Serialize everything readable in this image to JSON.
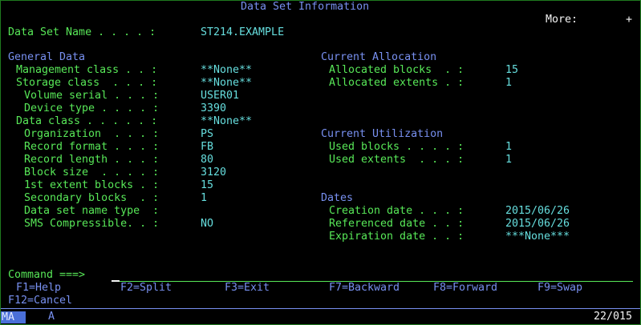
{
  "panel": {
    "title": "Data Set Information",
    "more_label": "More:",
    "more_indicator": "+"
  },
  "dataset": {
    "label": "Data Set Name . . . . :",
    "value": "ST214.EXAMPLE"
  },
  "general": {
    "heading": "General Data",
    "rows": [
      {
        "label": "Management class . . :",
        "value": "**None**"
      },
      {
        "label": "Storage class  . . . :",
        "value": "**None**"
      },
      {
        "label": "Volume serial . . . :",
        "value": "USER01"
      },
      {
        "label": "Device type . . . . :",
        "value": "3390"
      },
      {
        "label": "Data class . . . . . :",
        "value": "**None**"
      },
      {
        "label": "Organization  . . . :",
        "value": "PS"
      },
      {
        "label": "Record format . . . :",
        "value": "FB"
      },
      {
        "label": "Record length . . . :",
        "value": "80"
      },
      {
        "label": "Block size  . . . . :",
        "value": "3120"
      },
      {
        "label": "1st extent blocks . :",
        "value": "15"
      },
      {
        "label": "Secondary blocks  . :",
        "value": "1"
      },
      {
        "label": "Data set name type  :",
        "value": ""
      },
      {
        "label": "SMS Compressible. . :",
        "value": "NO"
      }
    ]
  },
  "allocation": {
    "heading": "Current Allocation",
    "rows": [
      {
        "label": "Allocated blocks  . :",
        "value": "15"
      },
      {
        "label": "Allocated extents . :",
        "value": "1"
      }
    ]
  },
  "utilization": {
    "heading": "Current Utilization",
    "rows": [
      {
        "label": "Used blocks . . . . :",
        "value": "1"
      },
      {
        "label": "Used extents  . . . :",
        "value": "1"
      }
    ]
  },
  "dates": {
    "heading": "Dates",
    "rows": [
      {
        "label": "Creation date . . . :",
        "value": "2015/06/26"
      },
      {
        "label": "Referenced date . . :",
        "value": "2015/06/26"
      },
      {
        "label": "Expiration date . . :",
        "value": "***None***"
      }
    ]
  },
  "command": {
    "label": "Command ===>",
    "value": ""
  },
  "function_keys": [
    "F1=Help",
    "F2=Split",
    "F3=Exit",
    "F7=Backward",
    "F8=Forward",
    "F9=Swap",
    "F12=Cancel"
  ],
  "status": {
    "mode": "MA",
    "indicator": "A",
    "cursor_position": "22/015"
  },
  "colors": {
    "label": "#7890f0",
    "heading": "#58e858",
    "value": "#66dede",
    "text": "#f4f4f4"
  }
}
